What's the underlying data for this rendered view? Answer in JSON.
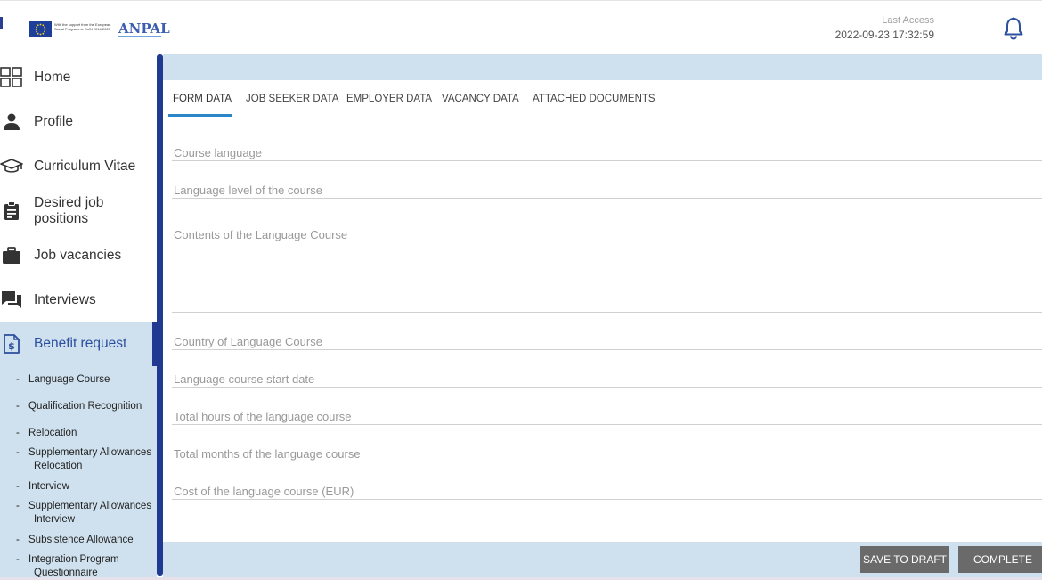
{
  "header": {
    "eu_text": "With the support from the European Social Programme EaSI 2014-2020",
    "anpal_logo": "ANPAL",
    "last_access_label": "Last Access",
    "last_access_value": "2022-09-23 17:32:59"
  },
  "sidebar": {
    "items": [
      {
        "label": "Home",
        "icon": "grid-icon"
      },
      {
        "label": "Profile",
        "icon": "person-icon"
      },
      {
        "label": "Curriculum Vitae",
        "icon": "graduation-cap-icon"
      },
      {
        "label": "Desired job positions",
        "icon": "clipboard-icon"
      },
      {
        "label": "Job vacancies",
        "icon": "briefcase-icon"
      },
      {
        "label": "Interviews",
        "icon": "chat-icon"
      },
      {
        "label": "Benefit request",
        "icon": "dollar-document-icon"
      }
    ],
    "sub_items": [
      {
        "line1": "Language Course",
        "line2": ""
      },
      {
        "line1": "Qualification Recognition",
        "line2": ""
      },
      {
        "line1": "Relocation",
        "line2": ""
      },
      {
        "line1": "Supplementary Allowances",
        "line2": "Relocation"
      },
      {
        "line1": "Interview",
        "line2": ""
      },
      {
        "line1": "Supplementary Allowances",
        "line2": "Interview"
      },
      {
        "line1": "Subsistence Allowance",
        "line2": ""
      },
      {
        "line1": "Integration Program",
        "line2": "Questionnaire"
      }
    ],
    "dash": "-"
  },
  "tabs": [
    {
      "label": "FORM DATA",
      "active": true
    },
    {
      "label": "JOB SEEKER DATA",
      "active": false
    },
    {
      "label": "EMPLOYER DATA",
      "active": false
    },
    {
      "label": "VACANCY DATA",
      "active": false
    },
    {
      "label": "ATTACHED DOCUMENTS",
      "active": false
    }
  ],
  "form": {
    "course_language": "Course language",
    "language_level": "Language level of the course",
    "contents": "Contents of the Language Course",
    "country": "Country of Language Course",
    "start_date": "Language course start date",
    "total_hours": "Total hours of the language course",
    "total_months": "Total months of the language course",
    "cost": "Cost of the language course (EUR)"
  },
  "buttons": {
    "save_draft": "SAVE TO DRAFT",
    "complete": "COMPLETE"
  },
  "colors": {
    "accent": "#213a91",
    "light_blue": "#cfe1ee",
    "tab_underline": "#2a86c9",
    "button_gray": "#6a6a6a"
  }
}
